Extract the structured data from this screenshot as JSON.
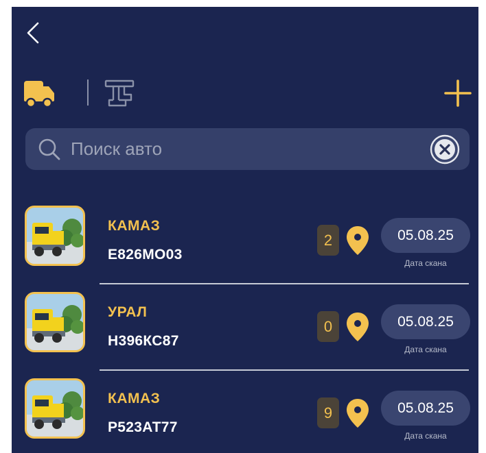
{
  "header": {
    "back_icon": "chevron-left-icon",
    "tabs": [
      {
        "icon": "truck-icon",
        "active": true,
        "color": "#F3C14F"
      },
      {
        "icon": "trailer-icon",
        "active": false,
        "color": "#8A91A8"
      }
    ],
    "add_icon": "plus-icon"
  },
  "search": {
    "placeholder": "Поиск авто",
    "value": "",
    "icon": "search-icon",
    "clear_icon": "close-circle-icon"
  },
  "vehicles": [
    {
      "brand": "КАМАЗ",
      "plate": "Е826МО03",
      "count": "2",
      "date": "05.08.25",
      "date_caption": "Дата скана"
    },
    {
      "brand": "УРАЛ",
      "plate": "Н396КС87",
      "count": "0",
      "date": "05.08.25",
      "date_caption": "Дата скана"
    },
    {
      "brand": "КАМАЗ",
      "plate": "Р523АТ77",
      "count": "9",
      "date": "05.08.25",
      "date_caption": "Дата скана"
    }
  ],
  "colors": {
    "background": "#1B2550",
    "accent": "#F3C14F",
    "search_bg": "#35406A",
    "pill_bg": "#3A4570",
    "badge_bg": "#4B4338"
  }
}
